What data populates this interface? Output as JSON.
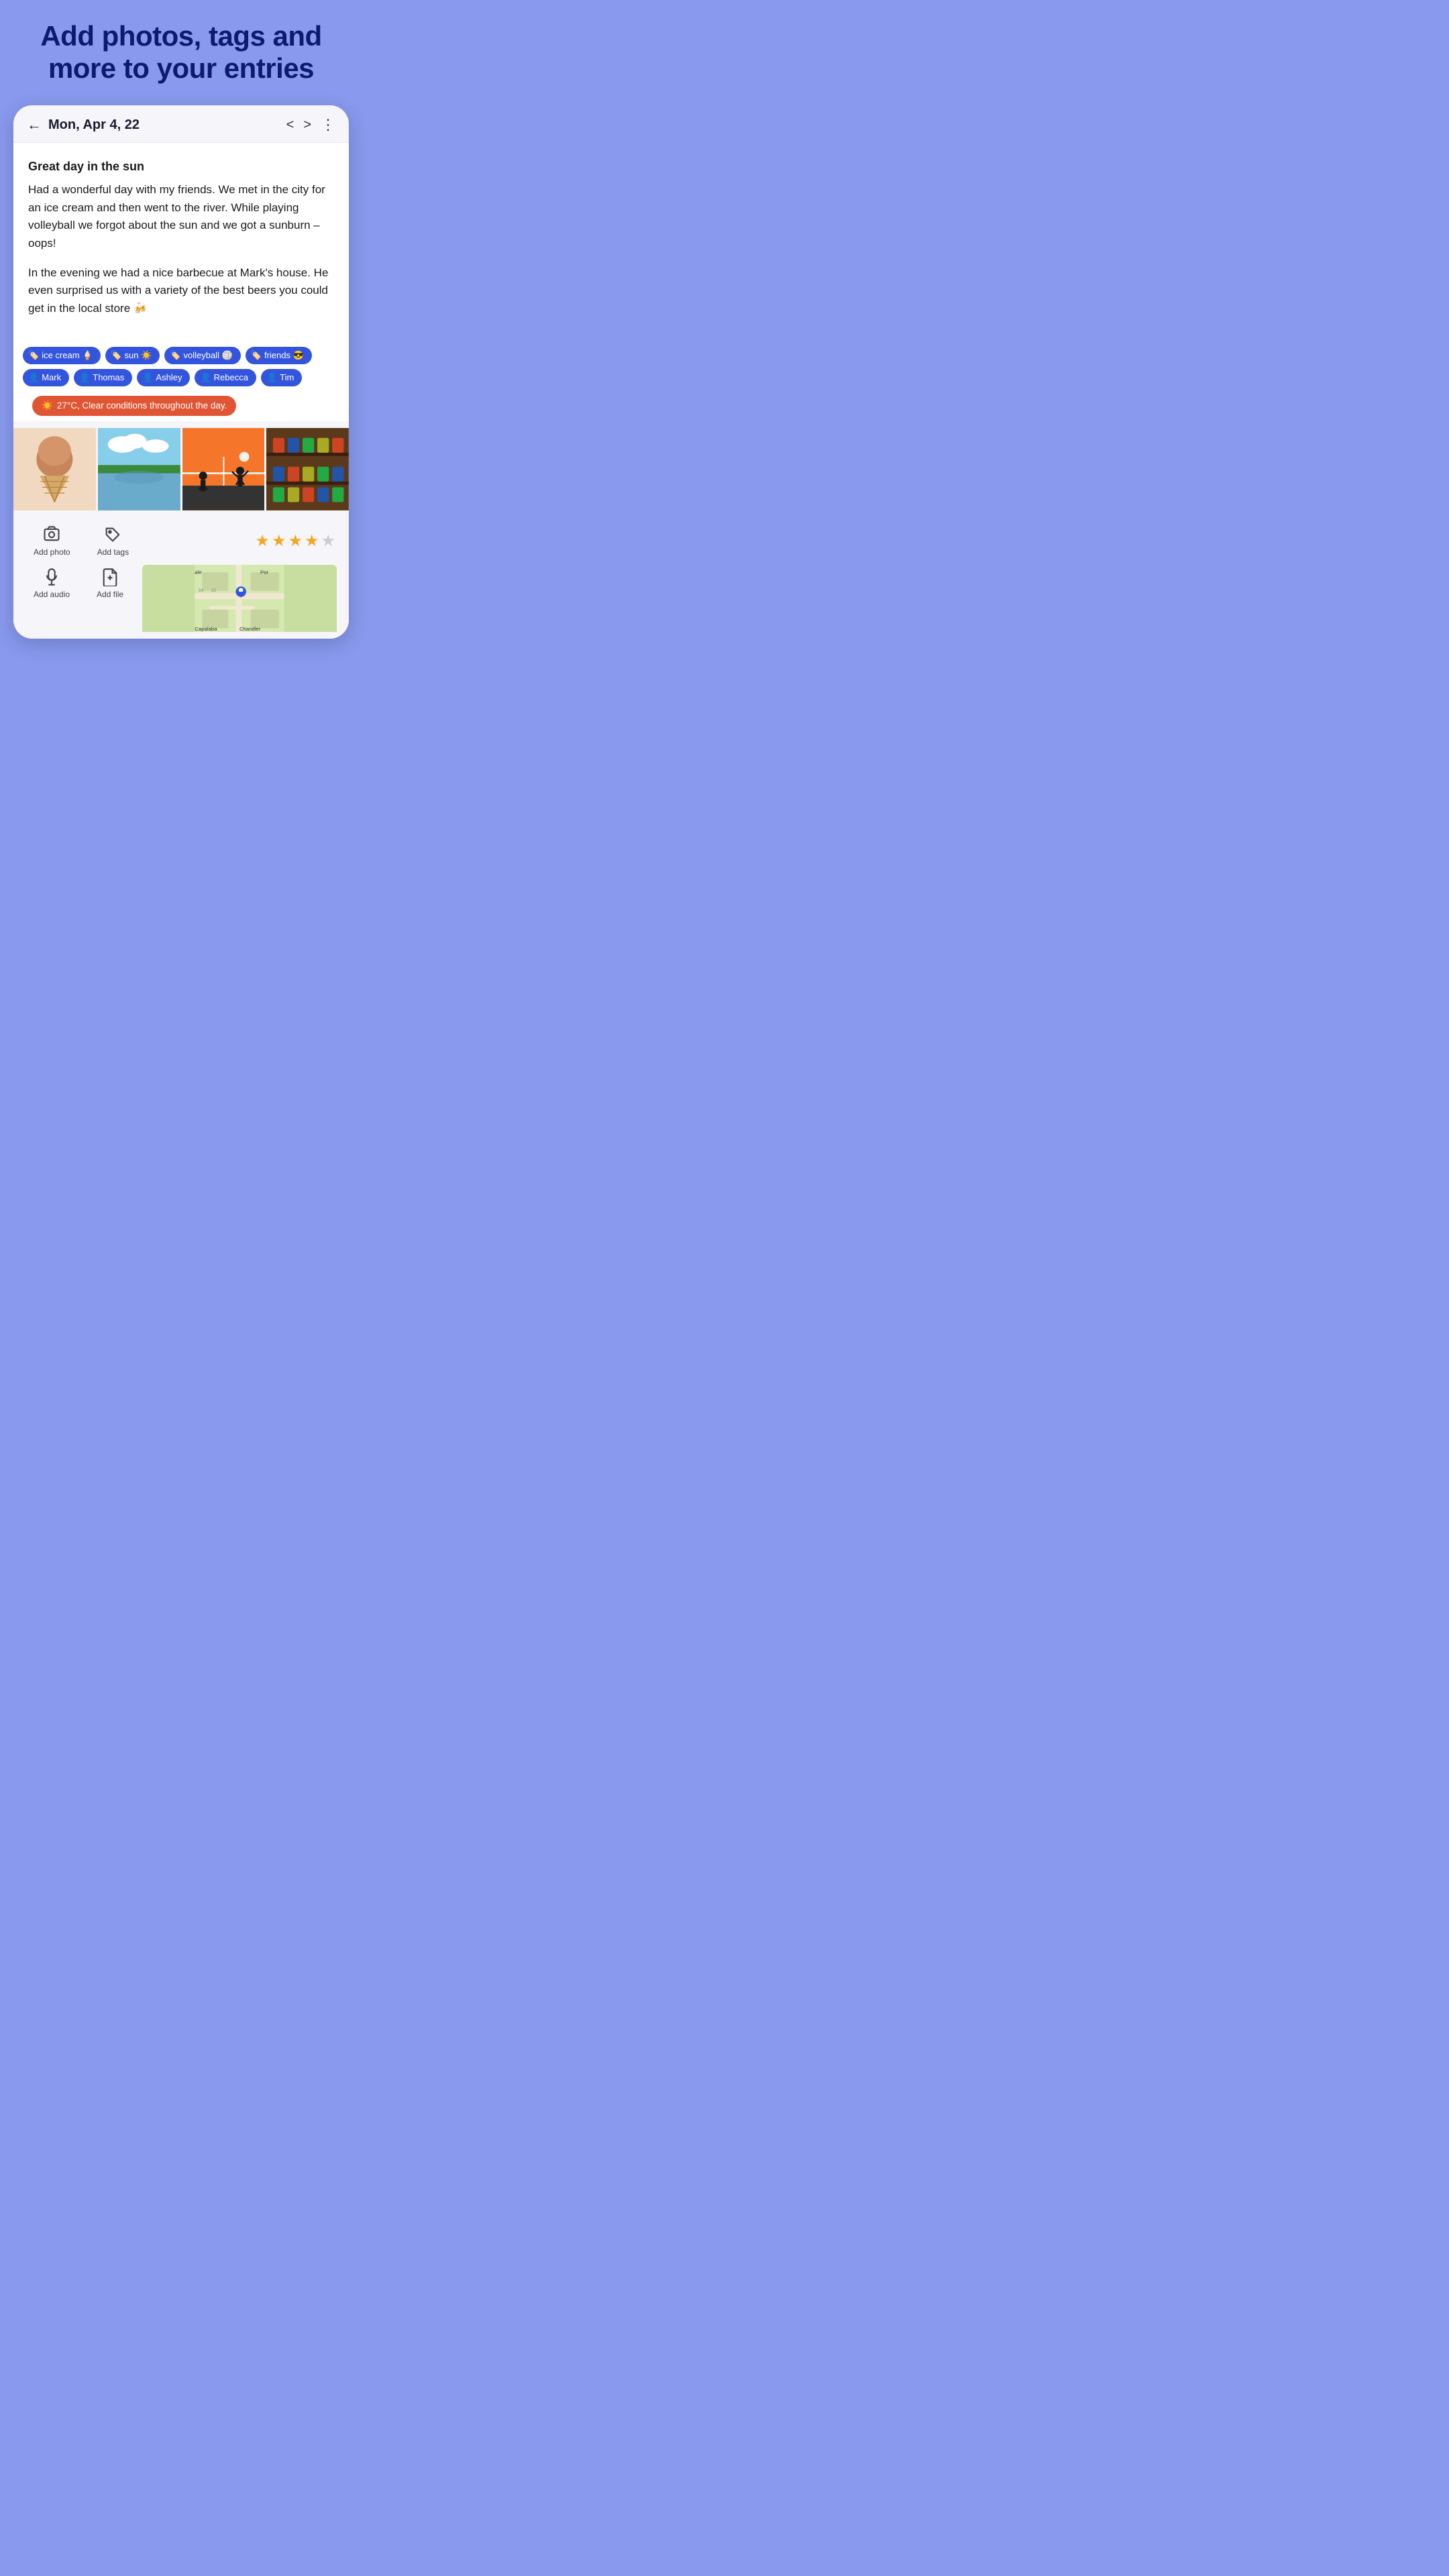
{
  "headline": {
    "line1": "Add photos, tags and",
    "line2": "more to your entries"
  },
  "header": {
    "back_label": "←",
    "date": "Mon, Apr 4, 22",
    "nav_left": "<",
    "nav_right": ">",
    "menu": "⋮"
  },
  "entry": {
    "title": "Great day in the sun",
    "paragraph1": "Had a wonderful day with my friends. We met in the city for an ice cream and then went to the river. While playing volleyball we forgot about the sun and we got a sunburn – oops!",
    "paragraph2": "In the evening we had a nice barbecue at Mark's house. He even surprised us with a variety of the best beers you could get in the local store 🍻"
  },
  "tags": [
    {
      "icon": "🏷️",
      "label": "ice cream 🍦"
    },
    {
      "icon": "🏷️",
      "label": "sun ☀️"
    },
    {
      "icon": "🏷️",
      "label": "volleyball 🏐"
    },
    {
      "icon": "🏷️",
      "label": "friends 😎"
    },
    {
      "icon": "👤",
      "label": "Mark"
    },
    {
      "icon": "👤",
      "label": "Thomas"
    },
    {
      "icon": "👤",
      "label": "Ashley"
    },
    {
      "icon": "👤",
      "label": "Rebecca"
    },
    {
      "icon": "👤",
      "label": "Tim"
    }
  ],
  "weather": {
    "icon": "☀️",
    "text": "27°C, Clear conditions throughout the day."
  },
  "photos": [
    {
      "alt": "ice cream cone",
      "color": "#f0d9c0"
    },
    {
      "alt": "river scene",
      "color": "#6aabcc"
    },
    {
      "alt": "volleyball silhouettes",
      "color": "#e8a040"
    },
    {
      "alt": "beer cans",
      "color": "#cc8855"
    }
  ],
  "actions": {
    "add_photo_label": "Add photo",
    "add_tags_label": "Add tags",
    "add_audio_label": "Add audio",
    "add_file_label": "Add file"
  },
  "rating": {
    "stars": 4,
    "max": 5
  },
  "map": {
    "label": "Chandler"
  }
}
